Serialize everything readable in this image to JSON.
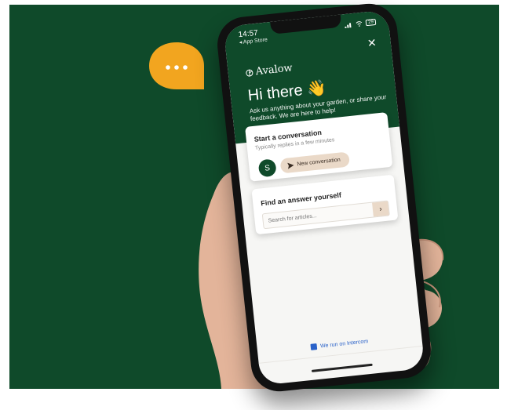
{
  "status": {
    "time": "14:57",
    "back_label": "◂ App Store",
    "battery": "29"
  },
  "header": {
    "brand": "Avalow",
    "greeting": "Hi there",
    "wave_emoji": "👋",
    "subtitle": "Ask us anything about your garden, or share your feedback. We are here to help!"
  },
  "conversation": {
    "title": "Start a conversation",
    "subtitle": "Typically replies in a few minutes",
    "avatar_initial": "S",
    "button_label": "New conversation"
  },
  "find": {
    "title": "Find an answer yourself",
    "placeholder": "Search for articles..."
  },
  "footer": {
    "powered_label": "We run on Intercom"
  },
  "colors": {
    "background": "#0f4a2a",
    "accent_bubble": "#f2a51f",
    "button_bg": "#ead9c8",
    "link": "#2a62c9"
  },
  "icons": [
    "chat-bubble-icon",
    "close-icon",
    "leaf-logo-icon",
    "send-icon",
    "chevron-right-icon",
    "intercom-icon",
    "signal-icon",
    "wifi-icon",
    "battery-icon"
  ]
}
